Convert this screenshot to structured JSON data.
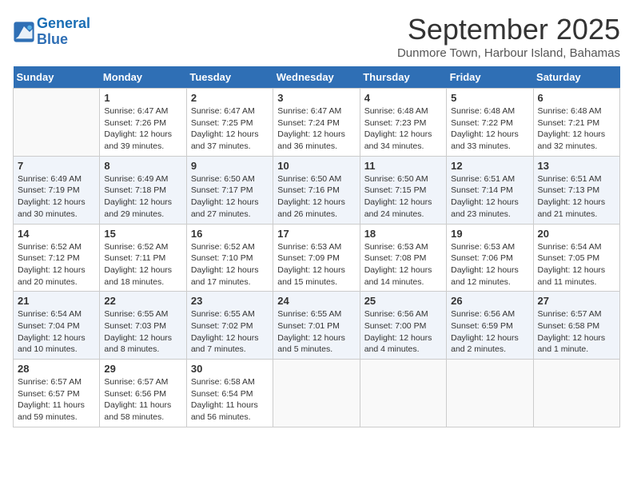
{
  "header": {
    "logo_line1": "General",
    "logo_line2": "Blue",
    "month_title": "September 2025",
    "subtitle": "Dunmore Town, Harbour Island, Bahamas"
  },
  "days_of_week": [
    "Sunday",
    "Monday",
    "Tuesday",
    "Wednesday",
    "Thursday",
    "Friday",
    "Saturday"
  ],
  "weeks": [
    [
      {
        "day": "",
        "info": ""
      },
      {
        "day": "1",
        "info": "Sunrise: 6:47 AM\nSunset: 7:26 PM\nDaylight: 12 hours\nand 39 minutes."
      },
      {
        "day": "2",
        "info": "Sunrise: 6:47 AM\nSunset: 7:25 PM\nDaylight: 12 hours\nand 37 minutes."
      },
      {
        "day": "3",
        "info": "Sunrise: 6:47 AM\nSunset: 7:24 PM\nDaylight: 12 hours\nand 36 minutes."
      },
      {
        "day": "4",
        "info": "Sunrise: 6:48 AM\nSunset: 7:23 PM\nDaylight: 12 hours\nand 34 minutes."
      },
      {
        "day": "5",
        "info": "Sunrise: 6:48 AM\nSunset: 7:22 PM\nDaylight: 12 hours\nand 33 minutes."
      },
      {
        "day": "6",
        "info": "Sunrise: 6:48 AM\nSunset: 7:21 PM\nDaylight: 12 hours\nand 32 minutes."
      }
    ],
    [
      {
        "day": "7",
        "info": "Sunrise: 6:49 AM\nSunset: 7:19 PM\nDaylight: 12 hours\nand 30 minutes."
      },
      {
        "day": "8",
        "info": "Sunrise: 6:49 AM\nSunset: 7:18 PM\nDaylight: 12 hours\nand 29 minutes."
      },
      {
        "day": "9",
        "info": "Sunrise: 6:50 AM\nSunset: 7:17 PM\nDaylight: 12 hours\nand 27 minutes."
      },
      {
        "day": "10",
        "info": "Sunrise: 6:50 AM\nSunset: 7:16 PM\nDaylight: 12 hours\nand 26 minutes."
      },
      {
        "day": "11",
        "info": "Sunrise: 6:50 AM\nSunset: 7:15 PM\nDaylight: 12 hours\nand 24 minutes."
      },
      {
        "day": "12",
        "info": "Sunrise: 6:51 AM\nSunset: 7:14 PM\nDaylight: 12 hours\nand 23 minutes."
      },
      {
        "day": "13",
        "info": "Sunrise: 6:51 AM\nSunset: 7:13 PM\nDaylight: 12 hours\nand 21 minutes."
      }
    ],
    [
      {
        "day": "14",
        "info": "Sunrise: 6:52 AM\nSunset: 7:12 PM\nDaylight: 12 hours\nand 20 minutes."
      },
      {
        "day": "15",
        "info": "Sunrise: 6:52 AM\nSunset: 7:11 PM\nDaylight: 12 hours\nand 18 minutes."
      },
      {
        "day": "16",
        "info": "Sunrise: 6:52 AM\nSunset: 7:10 PM\nDaylight: 12 hours\nand 17 minutes."
      },
      {
        "day": "17",
        "info": "Sunrise: 6:53 AM\nSunset: 7:09 PM\nDaylight: 12 hours\nand 15 minutes."
      },
      {
        "day": "18",
        "info": "Sunrise: 6:53 AM\nSunset: 7:08 PM\nDaylight: 12 hours\nand 14 minutes."
      },
      {
        "day": "19",
        "info": "Sunrise: 6:53 AM\nSunset: 7:06 PM\nDaylight: 12 hours\nand 12 minutes."
      },
      {
        "day": "20",
        "info": "Sunrise: 6:54 AM\nSunset: 7:05 PM\nDaylight: 12 hours\nand 11 minutes."
      }
    ],
    [
      {
        "day": "21",
        "info": "Sunrise: 6:54 AM\nSunset: 7:04 PM\nDaylight: 12 hours\nand 10 minutes."
      },
      {
        "day": "22",
        "info": "Sunrise: 6:55 AM\nSunset: 7:03 PM\nDaylight: 12 hours\nand 8 minutes."
      },
      {
        "day": "23",
        "info": "Sunrise: 6:55 AM\nSunset: 7:02 PM\nDaylight: 12 hours\nand 7 minutes."
      },
      {
        "day": "24",
        "info": "Sunrise: 6:55 AM\nSunset: 7:01 PM\nDaylight: 12 hours\nand 5 minutes."
      },
      {
        "day": "25",
        "info": "Sunrise: 6:56 AM\nSunset: 7:00 PM\nDaylight: 12 hours\nand 4 minutes."
      },
      {
        "day": "26",
        "info": "Sunrise: 6:56 AM\nSunset: 6:59 PM\nDaylight: 12 hours\nand 2 minutes."
      },
      {
        "day": "27",
        "info": "Sunrise: 6:57 AM\nSunset: 6:58 PM\nDaylight: 12 hours\nand 1 minute."
      }
    ],
    [
      {
        "day": "28",
        "info": "Sunrise: 6:57 AM\nSunset: 6:57 PM\nDaylight: 11 hours\nand 59 minutes."
      },
      {
        "day": "29",
        "info": "Sunrise: 6:57 AM\nSunset: 6:56 PM\nDaylight: 11 hours\nand 58 minutes."
      },
      {
        "day": "30",
        "info": "Sunrise: 6:58 AM\nSunset: 6:54 PM\nDaylight: 11 hours\nand 56 minutes."
      },
      {
        "day": "",
        "info": ""
      },
      {
        "day": "",
        "info": ""
      },
      {
        "day": "",
        "info": ""
      },
      {
        "day": "",
        "info": ""
      }
    ]
  ]
}
